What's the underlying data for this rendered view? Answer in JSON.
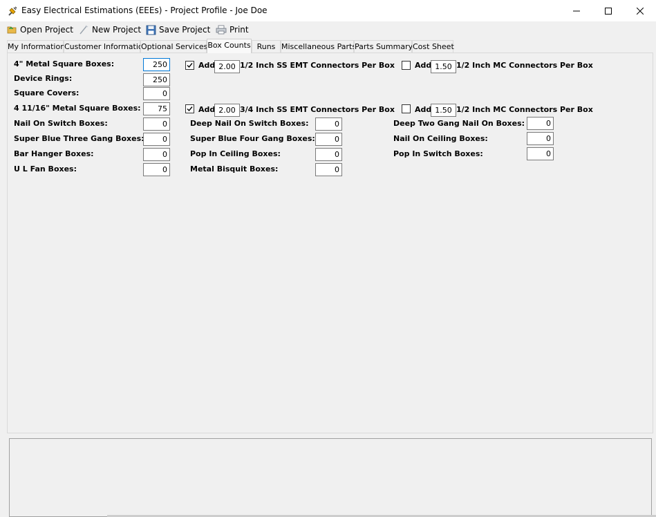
{
  "window": {
    "title": "Easy Electrical Estimations (EEEs) - Project Profile - Joe Doe"
  },
  "toolbar": {
    "open": "Open Project",
    "new": "New Project",
    "save": "Save Project",
    "print": "Print"
  },
  "tabs": [
    "My Information",
    "Customer Information",
    "Optional Services",
    "Box Counts",
    "Runs",
    "Miscellaneous Parts",
    "Parts Summary",
    "Cost Sheet"
  ],
  "active_tab": "Box Counts",
  "box_counts": {
    "metal_square_4": {
      "label": "4\" Metal Square Boxes:",
      "value": "250"
    },
    "device_rings": {
      "label": "Device Rings:",
      "value": "250"
    },
    "square_covers": {
      "label": "Square Covers:",
      "value": "0"
    },
    "metal_square_411": {
      "label": "4 11/16\" Metal Square Boxes:",
      "value": "75"
    },
    "nail_on_switch": {
      "label": "Nail On Switch Boxes:",
      "value": "0"
    },
    "super_blue_three": {
      "label": "Super Blue Three Gang Boxes:",
      "value": "0"
    },
    "bar_hanger": {
      "label": "Bar Hanger Boxes:",
      "value": "0"
    },
    "ul_fan": {
      "label": "U L Fan Boxes:",
      "value": "0"
    },
    "deep_nail_on_switch": {
      "label": "Deep Nail On Switch Boxes:",
      "value": "0"
    },
    "super_blue_four": {
      "label": "Super Blue Four Gang Boxes:",
      "value": "0"
    },
    "pop_in_ceiling": {
      "label": "Pop In Ceiling Boxes:",
      "value": "0"
    },
    "metal_bisquit": {
      "label": "Metal Bisquit Boxes:",
      "value": "0"
    },
    "deep_two_gang": {
      "label": "Deep Two Gang Nail On Boxes:",
      "value": "0"
    },
    "nail_on_ceiling": {
      "label": "Nail On Ceiling Boxes:",
      "value": "0"
    },
    "pop_in_switch": {
      "label": "Pop In Switch Boxes:",
      "value": "0"
    }
  },
  "connectors": {
    "add_label": "Add",
    "row1_emt": {
      "checked": true,
      "value": "2.00",
      "label": "1/2 Inch SS EMT Connectors Per Box"
    },
    "row1_mc": {
      "checked": false,
      "value": "1.50",
      "label": "1/2 Inch MC Connectors Per Box"
    },
    "row2_emt": {
      "checked": true,
      "value": "2.00",
      "label": "3/4 Inch SS EMT Connectors Per Box"
    },
    "row2_mc": {
      "checked": false,
      "value": "1.50",
      "label": "1/2 Inch MC Connectors Per Box"
    }
  },
  "colors": {
    "accent": "#0078d7",
    "panel": "#f0f0f0"
  }
}
